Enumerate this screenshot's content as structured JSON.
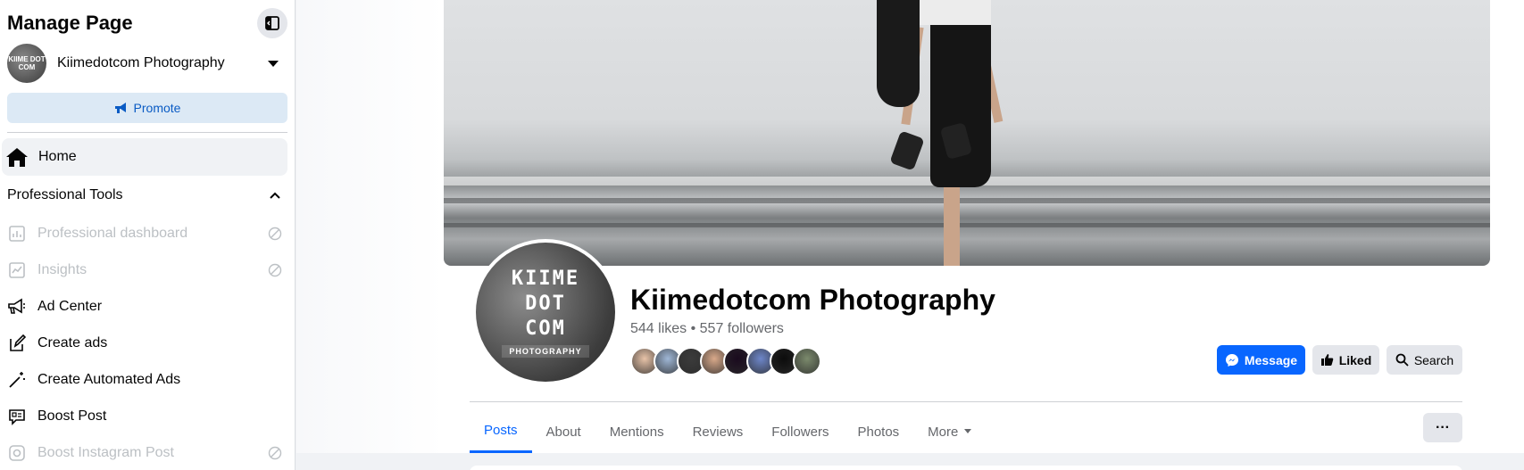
{
  "sidebar": {
    "title": "Manage Page",
    "page_name": "Kiimedotcom Photography",
    "avatar_text": "KIIME DOT COM",
    "promote_label": "Promote",
    "home_label": "Home",
    "section_label": "Professional Tools",
    "items": [
      {
        "label": "Professional dashboard",
        "icon": "dashboard-icon",
        "disabled": true
      },
      {
        "label": "Insights",
        "icon": "insights-icon",
        "disabled": true
      },
      {
        "label": "Ad Center",
        "icon": "megaphone-icon",
        "disabled": false
      },
      {
        "label": "Create ads",
        "icon": "pencil-icon",
        "disabled": false
      },
      {
        "label": "Create Automated Ads",
        "icon": "magic-wand-icon",
        "disabled": false
      },
      {
        "label": "Boost Post",
        "icon": "boost-post-icon",
        "disabled": false
      },
      {
        "label": "Boost Instagram Post",
        "icon": "instagram-icon",
        "disabled": true
      }
    ]
  },
  "profile": {
    "pic_lines": [
      "KIIME",
      "DOT",
      "COM"
    ],
    "pic_sub": "PHOTOGRAPHY",
    "name": "Kiimedotcom Photography",
    "stats": "544 likes • 557 followers",
    "friend_colors": [
      "#e8c3a8",
      "#9fb7d6",
      "#3b3b3b",
      "#d9a98a",
      "#1a0a1e",
      "#6d86c9",
      "#0c0c0c",
      "#7b8a6c"
    ]
  },
  "actions": {
    "message": "Message",
    "liked": "Liked",
    "search": "Search"
  },
  "tabs": [
    {
      "label": "Posts",
      "active": true
    },
    {
      "label": "About",
      "active": false
    },
    {
      "label": "Mentions",
      "active": false
    },
    {
      "label": "Reviews",
      "active": false
    },
    {
      "label": "Followers",
      "active": false
    },
    {
      "label": "Photos",
      "active": false
    },
    {
      "label": "More",
      "active": false
    }
  ],
  "more_options": "···",
  "colors": {
    "accent": "#0866ff",
    "promote_bg": "#dce9f5",
    "disabled_text": "#bcc0c4"
  }
}
